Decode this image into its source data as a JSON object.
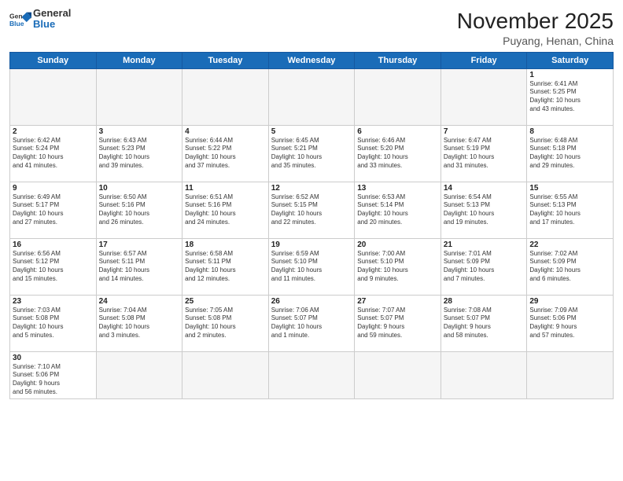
{
  "header": {
    "logo_general": "General",
    "logo_blue": "Blue",
    "title": "November 2025",
    "subtitle": "Puyang, Henan, China"
  },
  "weekdays": [
    "Sunday",
    "Monday",
    "Tuesday",
    "Wednesday",
    "Thursday",
    "Friday",
    "Saturday"
  ],
  "weeks": [
    [
      {
        "day": "",
        "info": ""
      },
      {
        "day": "",
        "info": ""
      },
      {
        "day": "",
        "info": ""
      },
      {
        "day": "",
        "info": ""
      },
      {
        "day": "",
        "info": ""
      },
      {
        "day": "",
        "info": ""
      },
      {
        "day": "1",
        "info": "Sunrise: 6:41 AM\nSunset: 5:25 PM\nDaylight: 10 hours\nand 43 minutes."
      }
    ],
    [
      {
        "day": "2",
        "info": "Sunrise: 6:42 AM\nSunset: 5:24 PM\nDaylight: 10 hours\nand 41 minutes."
      },
      {
        "day": "3",
        "info": "Sunrise: 6:43 AM\nSunset: 5:23 PM\nDaylight: 10 hours\nand 39 minutes."
      },
      {
        "day": "4",
        "info": "Sunrise: 6:44 AM\nSunset: 5:22 PM\nDaylight: 10 hours\nand 37 minutes."
      },
      {
        "day": "5",
        "info": "Sunrise: 6:45 AM\nSunset: 5:21 PM\nDaylight: 10 hours\nand 35 minutes."
      },
      {
        "day": "6",
        "info": "Sunrise: 6:46 AM\nSunset: 5:20 PM\nDaylight: 10 hours\nand 33 minutes."
      },
      {
        "day": "7",
        "info": "Sunrise: 6:47 AM\nSunset: 5:19 PM\nDaylight: 10 hours\nand 31 minutes."
      },
      {
        "day": "8",
        "info": "Sunrise: 6:48 AM\nSunset: 5:18 PM\nDaylight: 10 hours\nand 29 minutes."
      }
    ],
    [
      {
        "day": "9",
        "info": "Sunrise: 6:49 AM\nSunset: 5:17 PM\nDaylight: 10 hours\nand 27 minutes."
      },
      {
        "day": "10",
        "info": "Sunrise: 6:50 AM\nSunset: 5:16 PM\nDaylight: 10 hours\nand 26 minutes."
      },
      {
        "day": "11",
        "info": "Sunrise: 6:51 AM\nSunset: 5:16 PM\nDaylight: 10 hours\nand 24 minutes."
      },
      {
        "day": "12",
        "info": "Sunrise: 6:52 AM\nSunset: 5:15 PM\nDaylight: 10 hours\nand 22 minutes."
      },
      {
        "day": "13",
        "info": "Sunrise: 6:53 AM\nSunset: 5:14 PM\nDaylight: 10 hours\nand 20 minutes."
      },
      {
        "day": "14",
        "info": "Sunrise: 6:54 AM\nSunset: 5:13 PM\nDaylight: 10 hours\nand 19 minutes."
      },
      {
        "day": "15",
        "info": "Sunrise: 6:55 AM\nSunset: 5:13 PM\nDaylight: 10 hours\nand 17 minutes."
      }
    ],
    [
      {
        "day": "16",
        "info": "Sunrise: 6:56 AM\nSunset: 5:12 PM\nDaylight: 10 hours\nand 15 minutes."
      },
      {
        "day": "17",
        "info": "Sunrise: 6:57 AM\nSunset: 5:11 PM\nDaylight: 10 hours\nand 14 minutes."
      },
      {
        "day": "18",
        "info": "Sunrise: 6:58 AM\nSunset: 5:11 PM\nDaylight: 10 hours\nand 12 minutes."
      },
      {
        "day": "19",
        "info": "Sunrise: 6:59 AM\nSunset: 5:10 PM\nDaylight: 10 hours\nand 11 minutes."
      },
      {
        "day": "20",
        "info": "Sunrise: 7:00 AM\nSunset: 5:10 PM\nDaylight: 10 hours\nand 9 minutes."
      },
      {
        "day": "21",
        "info": "Sunrise: 7:01 AM\nSunset: 5:09 PM\nDaylight: 10 hours\nand 7 minutes."
      },
      {
        "day": "22",
        "info": "Sunrise: 7:02 AM\nSunset: 5:09 PM\nDaylight: 10 hours\nand 6 minutes."
      }
    ],
    [
      {
        "day": "23",
        "info": "Sunrise: 7:03 AM\nSunset: 5:08 PM\nDaylight: 10 hours\nand 5 minutes."
      },
      {
        "day": "24",
        "info": "Sunrise: 7:04 AM\nSunset: 5:08 PM\nDaylight: 10 hours\nand 3 minutes."
      },
      {
        "day": "25",
        "info": "Sunrise: 7:05 AM\nSunset: 5:08 PM\nDaylight: 10 hours\nand 2 minutes."
      },
      {
        "day": "26",
        "info": "Sunrise: 7:06 AM\nSunset: 5:07 PM\nDaylight: 10 hours\nand 1 minute."
      },
      {
        "day": "27",
        "info": "Sunrise: 7:07 AM\nSunset: 5:07 PM\nDaylight: 9 hours\nand 59 minutes."
      },
      {
        "day": "28",
        "info": "Sunrise: 7:08 AM\nSunset: 5:07 PM\nDaylight: 9 hours\nand 58 minutes."
      },
      {
        "day": "29",
        "info": "Sunrise: 7:09 AM\nSunset: 5:06 PM\nDaylight: 9 hours\nand 57 minutes."
      }
    ],
    [
      {
        "day": "30",
        "info": "Sunrise: 7:10 AM\nSunset: 5:06 PM\nDaylight: 9 hours\nand 56 minutes."
      },
      {
        "day": "",
        "info": ""
      },
      {
        "day": "",
        "info": ""
      },
      {
        "day": "",
        "info": ""
      },
      {
        "day": "",
        "info": ""
      },
      {
        "day": "",
        "info": ""
      },
      {
        "day": "",
        "info": ""
      }
    ]
  ]
}
